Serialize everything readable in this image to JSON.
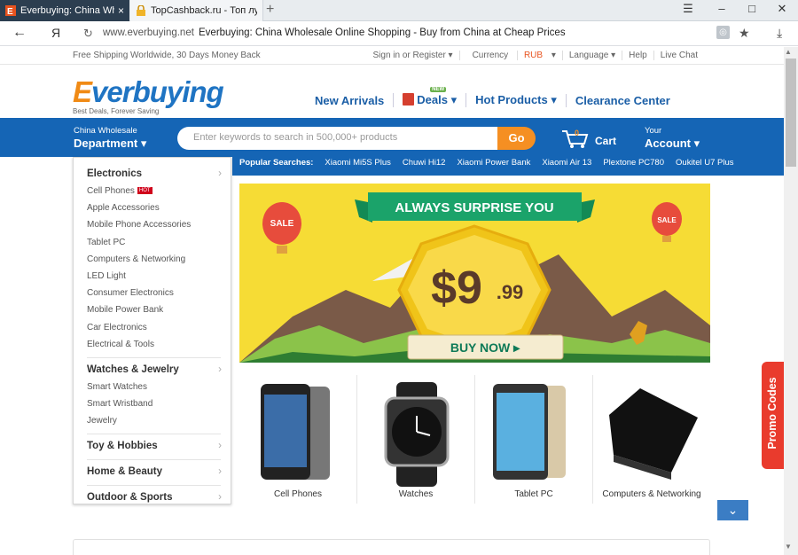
{
  "browser": {
    "tabs": [
      {
        "title": "Everbuying: China Wholes",
        "active": true
      },
      {
        "title": "TopCashback.ru - Топ лучш",
        "active": false
      }
    ],
    "url": "www.everbuying.net",
    "page_title": "Everbuying: China Wholesale Online Shopping - Buy from China at Cheap Prices",
    "back_icon": "arrow-left-icon",
    "yandex_label": "Я"
  },
  "topbar": {
    "shipping": "Free Shipping Worldwide, 30 Days Money Back",
    "signin": "Sign in or Register ▾",
    "currency_label": "Currency",
    "currency_value": "RUB",
    "language": "Language ▾",
    "help": "Help",
    "live_chat": "Live Chat"
  },
  "logo": {
    "text_e": "E",
    "text_rest": "verbuying",
    "tagline": "Best Deals, Forever Saving"
  },
  "mainnav": {
    "new_arrivals": "New Arrivals",
    "deals": "Deals",
    "deals_badge": "NEW",
    "hot_products": "Hot Products",
    "clearance": "Clearance Center"
  },
  "header": {
    "china_wholesale": "China Wholesale",
    "department": "Department ▾",
    "search_placeholder": "Enter keywords to search in 500,000+ products",
    "go": "Go",
    "cart_count": "0",
    "cart": "Cart",
    "your": "Your",
    "account": "Account ▾"
  },
  "popular": {
    "label": "Popular Searches:",
    "items": [
      "Xiaomi Mi5S Plus",
      "Chuwi Hi12",
      "Xiaomi Power Bank",
      "Xiaomi Air 13",
      "Plextone PC780",
      "Oukitel U7 Plus"
    ]
  },
  "categories": {
    "electronics": {
      "title": "Electronics",
      "items": [
        "Cell Phones",
        "Apple Accessories",
        "Mobile Phone Accessories",
        "Tablet PC",
        "Computers & Networking",
        "LED Light",
        "Consumer Electronics",
        "Mobile Power Bank",
        "Car Electronics",
        "Electrical & Tools"
      ],
      "hot_badge": "HOT"
    },
    "watches": {
      "title": "Watches & Jewelry",
      "items": [
        "Smart Watches",
        "Smart Wristband",
        "Jewelry"
      ]
    },
    "toy": "Toy & Hobbies",
    "home": "Home & Beauty",
    "outdoor": "Outdoor & Sports"
  },
  "banner": {
    "ribbon": "ALWAYS SURPRISE YOU",
    "price_main": "$9",
    "price_cents": ".99",
    "buy_now": "BUY NOW ▸",
    "balloon_text": "SALE"
  },
  "products": [
    "Cell Phones",
    "Watches",
    "Tablet PC",
    "Computers & Networking"
  ],
  "promo": "Promo Codes",
  "colors": {
    "brand_blue": "#1565b5",
    "brand_orange": "#f58f22",
    "promo_red": "#e93b2d",
    "banner_yellow": "#f6dc35"
  }
}
